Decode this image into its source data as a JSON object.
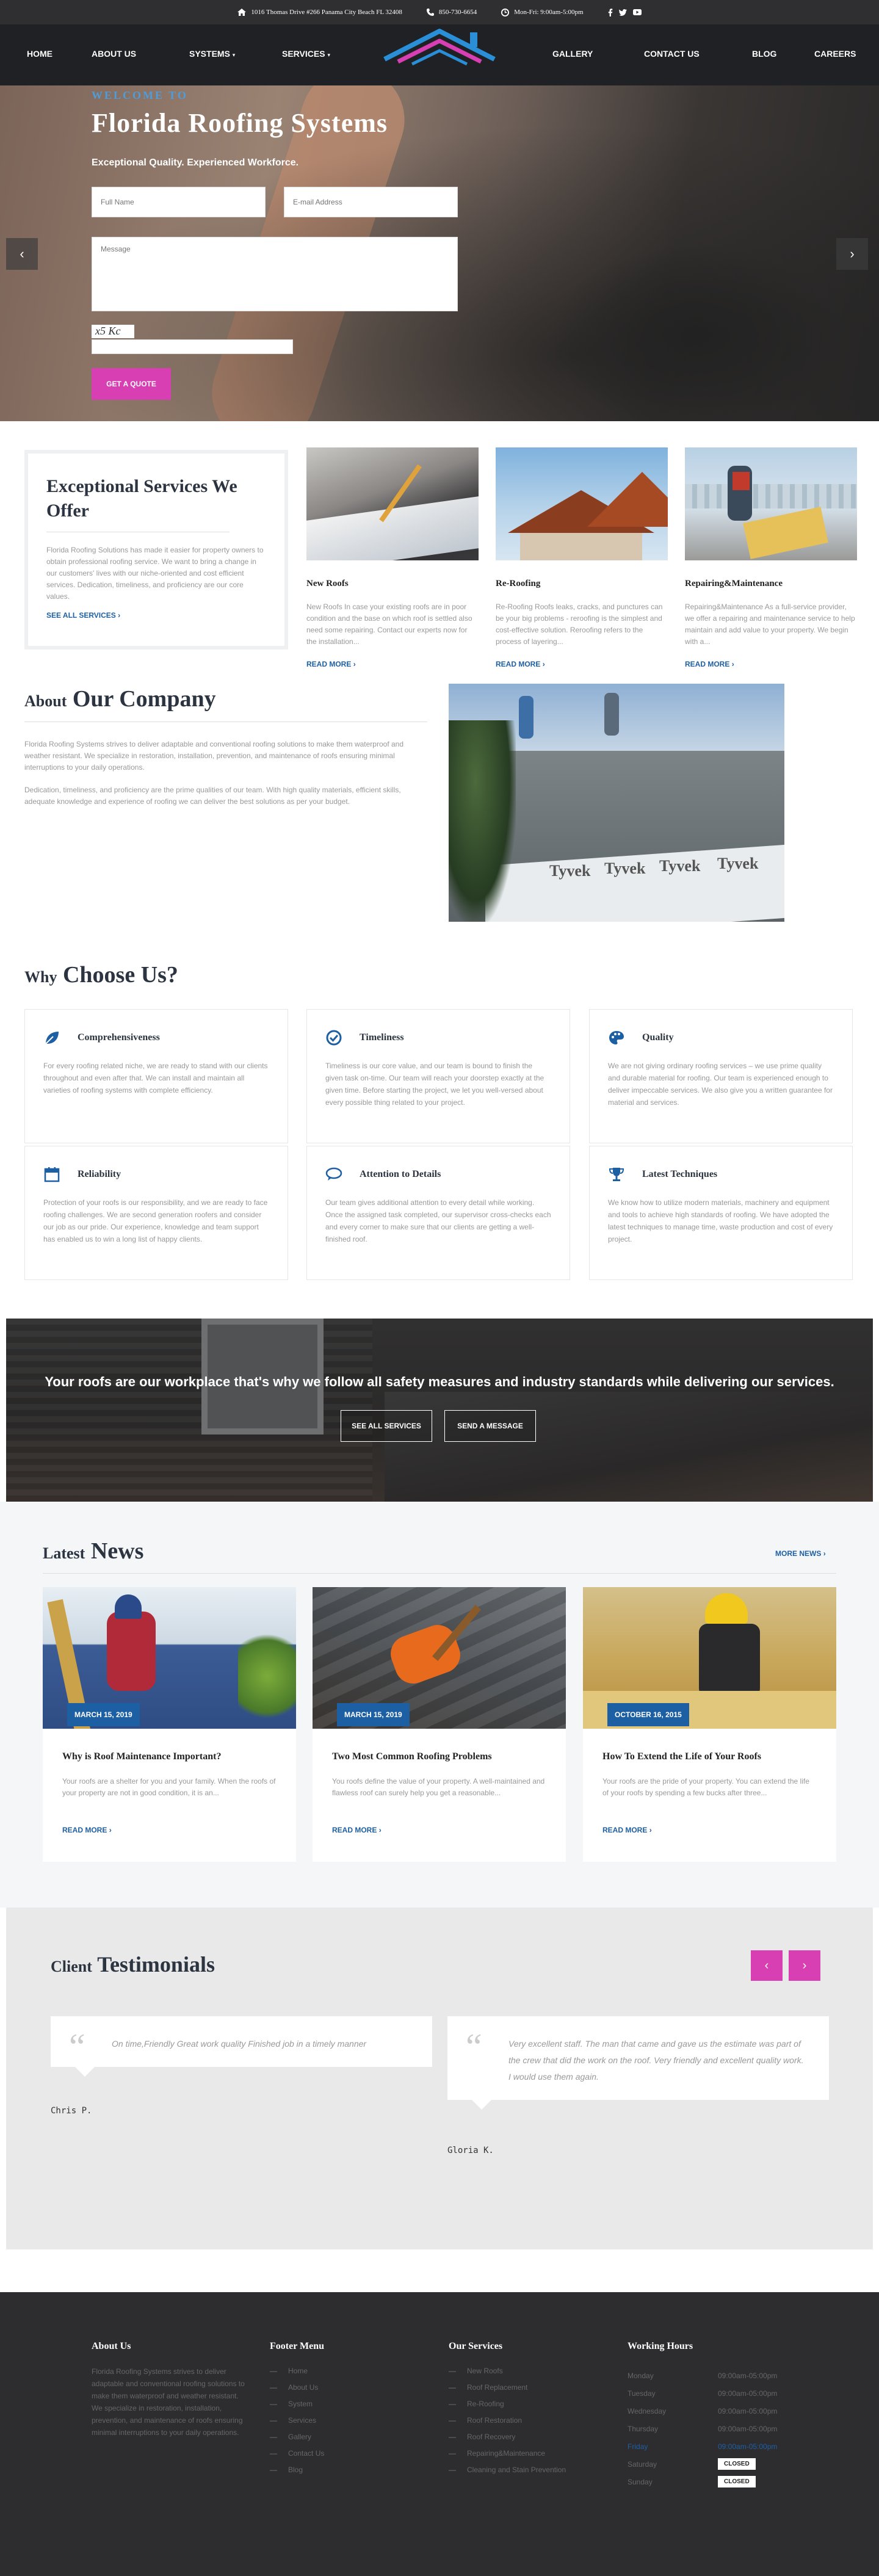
{
  "topbar": {
    "address": "1016 Thomas Drive #266 Panama City Beach FL 32408",
    "phone": "850-730-6654",
    "hours": "Mon-Fri: 9:00am-5:00pm"
  },
  "nav": {
    "home": "HOME",
    "about": "ABOUT US",
    "systems": "SYSTEMS",
    "services": "SERVICES",
    "gallery": "GALLERY",
    "contact": "CONTACT US",
    "blog": "BLOG",
    "careers": "CAREERS"
  },
  "hero": {
    "welcome": "WELCOME TO",
    "title": "Florida Roofing Systems",
    "tagline": "Exceptional Quality. Experienced Workforce.",
    "name_placeholder": "Full Name",
    "email_placeholder": "E-mail Address",
    "message_placeholder": "Message",
    "captcha": "x5 Kc",
    "quote_button": "GET A QUOTE"
  },
  "services_intro": {
    "title": "Exceptional Services We Offer",
    "text": "Florida Roofing Solutions has made it easier for property owners to obtain professional roofing service. We want to bring a change in our customers' lives with our niche-oriented and cost efficient services. Dedication, timeliness, and proficiency are our core values.",
    "link": "SEE ALL SERVICES"
  },
  "services": [
    {
      "title": "New Roofs",
      "text": "New Roofs   In case your existing roofs are in poor condition and the base on which roof is settled also need some repairing. Contact our experts now for the installation...",
      "link": "READ MORE"
    },
    {
      "title": "Re-Roofing",
      "text": "Re-Roofing Roofs leaks, cracks, and punctures can be your big problems - reroofing is the simplest and cost-effective solution. Reroofing refers to the process of layering...",
      "link": "READ MORE"
    },
    {
      "title": "Repairing&Maintenance",
      "text": "Repairing&Maintenance  As a full-service provider, we offer a repairing and maintenance service to help maintain and add value to your property. We begin with a...",
      "link": "READ MORE"
    }
  ],
  "about": {
    "title_small": "About",
    "title_big": "Our Company",
    "p1": "Florida Roofing Systems strives to deliver adaptable and conventional roofing solutions to make them waterproof and weather resistant. We specialize in restoration, installation, prevention, and maintenance of roofs ensuring minimal interruptions to your daily operations.",
    "p2": "Dedication, timeliness, and proficiency are the prime qualities of our team. With high quality materials, efficient skills, adequate knowledge and experience of roofing we can deliver the best solutions as per your budget.",
    "photo_text": "Tyvek"
  },
  "why": {
    "title_small": "Why",
    "title_big": "Choose Us?",
    "items": [
      {
        "title": "Comprehensiveness",
        "icon": "leaf-icon",
        "text": "For every roofing related niche, we are ready to stand with our clients throughout and even after that. We can install and maintain all varieties of roofing systems with complete efficiency."
      },
      {
        "title": "Timeliness",
        "icon": "check-circle-icon",
        "text": "Timeliness is our core value, and our team is bound to finish the given task on-time. Our team will reach your doorstep exactly at the given time. Before starting the project, we let you well-versed about every possible thing related to your project."
      },
      {
        "title": "Quality",
        "icon": "palette-icon",
        "text": "We are not giving ordinary roofing services – we use prime quality and durable material for roofing. Our team is experienced enough to deliver impeccable services. We also give you a written guarantee for material and services."
      },
      {
        "title": "Reliability",
        "icon": "calendar-icon",
        "text": "Protection of your roofs is our responsibility, and we are ready to face roofing challenges. We are second generation roofers and consider our job as our pride. Our experience, knowledge and team support has enabled us to win a long list of happy clients."
      },
      {
        "title": "Attention to Details",
        "icon": "chat-icon",
        "text": "Our team gives additional attention to every detail while working. Once the assigned task completed, our supervisor cross-checks each and every corner to make sure that our clients are getting a well-finished roof."
      },
      {
        "title": "Latest Techniques",
        "icon": "trophy-icon",
        "text": "We know how to utilize modern materials, machinery and equipment and tools to achieve high standards of roofing. We have adopted the latest techniques to manage time, waste production and cost of every project."
      }
    ]
  },
  "banner": {
    "text": "Your roofs are our workplace that's why we follow all safety measures and industry standards while delivering our services.",
    "btn1": "SEE ALL SERVICES",
    "btn2": "SEND A MESSAGE"
  },
  "news": {
    "title_small": "Latest",
    "title_big": "News",
    "more": "MORE NEWS",
    "items": [
      {
        "date": "MARCH 15, 2019",
        "title": "Why is Roof Maintenance Important?",
        "text": "Your roofs are a shelter for you and your family. When the roofs of your property are not in good condition, it is an...",
        "link": "READ MORE"
      },
      {
        "date": "MARCH 15, 2019",
        "title": "Two Most Common Roofing Problems",
        "text": "You roofs define the value of your property. A well-maintained and flawless roof can surely help you get a reasonable...",
        "link": "READ MORE"
      },
      {
        "date": "OCTOBER 16, 2015",
        "title": "How To Extend the Life of Your Roofs",
        "text": "Your roofs are the pride of your property. You can extend the life of your roofs by spending a few bucks after three...",
        "link": "READ MORE"
      }
    ]
  },
  "testimonials": {
    "title_small": "Client",
    "title_big": "Testimonials",
    "prev": "‹",
    "next": "›",
    "items": [
      {
        "quote": "On time,Friendly Great work quality Finished job in a timely manner",
        "name": "Chris P."
      },
      {
        "quote": "Very excellent staff. The man that came and gave us the estimate was part of the crew that did the work on the roof. Very friendly and excellent quality work. I would use them again.",
        "name": "Gloria K."
      }
    ]
  },
  "footer": {
    "about_title": "About Us",
    "about_text": "Florida Roofing Systems strives to deliver adaptable and conventional roofing solutions to make them waterproof and weather resistant. We specialize in restoration, installation, prevention, and maintenance of roofs ensuring minimal interruptions to your daily operations.",
    "menu_title": "Footer Menu",
    "menu": [
      "Home",
      "About Us",
      "System",
      "Services",
      "Gallery",
      "Contact Us",
      "Blog"
    ],
    "services_title": "Our Services",
    "services": [
      "New Roofs",
      "Roof Replacement",
      "Re-Roofing",
      "Roof Restoration",
      "Roof Recovery",
      "Repairing&Maintenance",
      "Cleaning and Stain Prevention"
    ],
    "hours_title": "Working Hours",
    "hours": [
      {
        "day": "Monday",
        "time": "09:00am-05:00pm"
      },
      {
        "day": "Tuesday",
        "time": "09:00am-05:00pm"
      },
      {
        "day": "Wednesday",
        "time": "09:00am-05:00pm"
      },
      {
        "day": "Thursday",
        "time": "09:00am-05:00pm"
      },
      {
        "day": "Friday",
        "time": "09:00am-05:00pm"
      },
      {
        "day": "Saturday",
        "time": "CLOSED"
      },
      {
        "day": "Sunday",
        "time": "CLOSED"
      }
    ]
  },
  "colors": {
    "accent": "#d73fb2",
    "link": "#1d5fa3",
    "dark": "#1f2125"
  }
}
